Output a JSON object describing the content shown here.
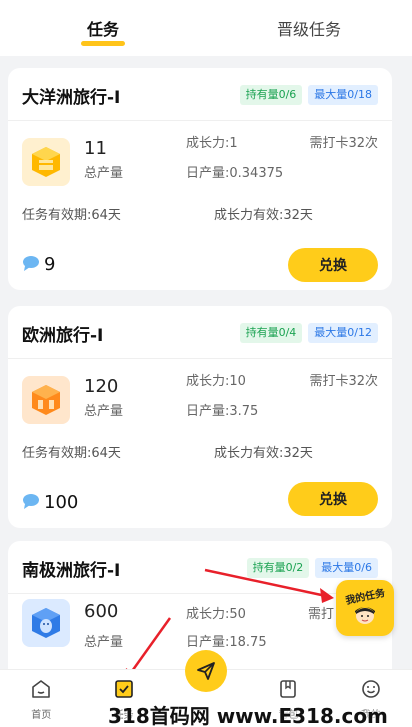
{
  "tabs": [
    {
      "label": "任务",
      "active": true
    },
    {
      "label": "晋级任务",
      "active": false
    }
  ],
  "cards": [
    {
      "title": "大洋洲旅行-I",
      "badge_hold": "持有量0/6",
      "badge_max": "最大量0/18",
      "output": "11",
      "output_label": "总产量",
      "growth": "成长力:1",
      "daily": "日产量:0.34375",
      "checkins": "需打卡32次",
      "task_validity": "任务有效期:64天",
      "growth_validity": "成长力有效:32天",
      "bubbles": "9",
      "button": "兑换",
      "icon": "gold-box-icon"
    },
    {
      "title": "欧洲旅行-I",
      "badge_hold": "持有量0/4",
      "badge_max": "最大量0/12",
      "output": "120",
      "output_label": "总产量",
      "growth": "成长力:10",
      "daily": "日产量:3.75",
      "checkins": "需打卡32次",
      "task_validity": "任务有效期:64天",
      "growth_validity": "成长力有效:32天",
      "bubbles": "100",
      "button": "兑换",
      "icon": "orange-building-icon"
    },
    {
      "title": "南极洲旅行-I",
      "badge_hold": "持有量0/2",
      "badge_max": "最大量0/6",
      "output": "600",
      "output_label": "总产量",
      "growth": "成长力:50",
      "daily": "日产量:18.75",
      "checkins": "需打",
      "icon": "blue-penguin-icon"
    }
  ],
  "float_button": {
    "label": "我的任务"
  },
  "nav": [
    {
      "label": "首页",
      "icon": "home-icon"
    },
    {
      "label": "任务",
      "icon": "task-check-icon",
      "active": true
    },
    {
      "label": "",
      "icon": "send-icon"
    },
    {
      "label": "背包",
      "icon": "bookmark-icon"
    },
    {
      "label": "我的",
      "icon": "smile-icon"
    }
  ],
  "watermark": "318首码网 www.E318.com",
  "colors": {
    "accent": "#ffcc1a",
    "hold_green": "#1aa251",
    "max_blue": "#2b77e6",
    "arrow_red": "#e8202a"
  }
}
